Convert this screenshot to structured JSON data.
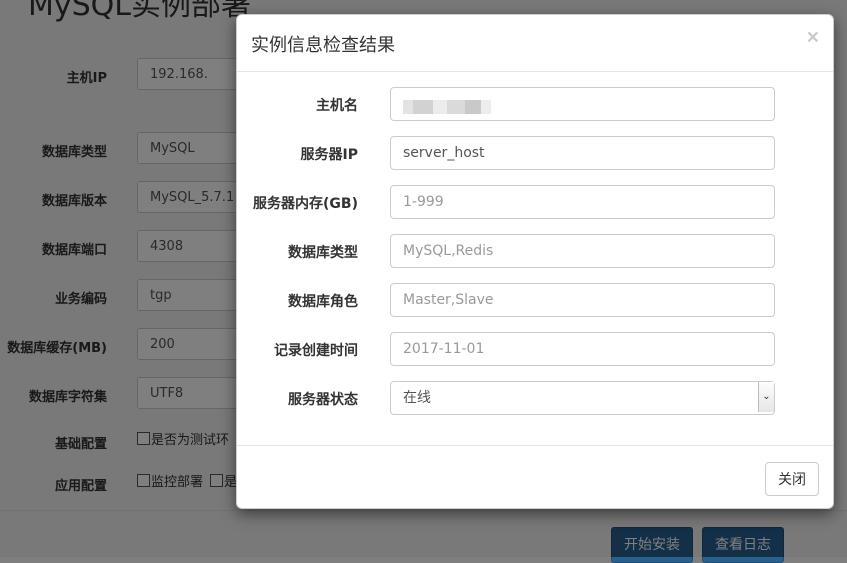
{
  "background": {
    "page_title": "MySQL实例部署",
    "fields": [
      {
        "label": "主机IP",
        "value": "192.168."
      },
      {
        "label": "数据库类型",
        "value": "MySQL"
      },
      {
        "label": "数据库版本",
        "value": "MySQL_5.7.1"
      },
      {
        "label": "数据库端口",
        "value": "4308"
      },
      {
        "label": "业务编码",
        "value": "tgp"
      },
      {
        "label": "数据库缓存(MB)",
        "value": "200"
      },
      {
        "label": "数据库字符集",
        "value": "UTF8"
      }
    ],
    "basic_config": {
      "label": "基础配置",
      "option": "是否为测试环"
    },
    "app_config": {
      "label": "应用配置",
      "option": "监控部署",
      "option2": "是"
    },
    "install_button": "开始安装",
    "log_button": "查看日志"
  },
  "modal": {
    "title": "实例信息检查结果",
    "close_symbol": "×",
    "fields": {
      "hostname": {
        "label": "主机名",
        "value": ""
      },
      "server_ip": {
        "label": "服务器IP",
        "value": "server_host"
      },
      "memory": {
        "label": "服务器内存(GB)",
        "placeholder": "1-999"
      },
      "db_type": {
        "label": "数据库类型",
        "placeholder": "MySQL,Redis"
      },
      "db_role": {
        "label": "数据库角色",
        "placeholder": "Master,Slave"
      },
      "created": {
        "label": "记录创建时间",
        "placeholder": "2017-11-01"
      },
      "status": {
        "label": "服务器状态",
        "value": "在线"
      }
    },
    "close_button": "关闭"
  }
}
